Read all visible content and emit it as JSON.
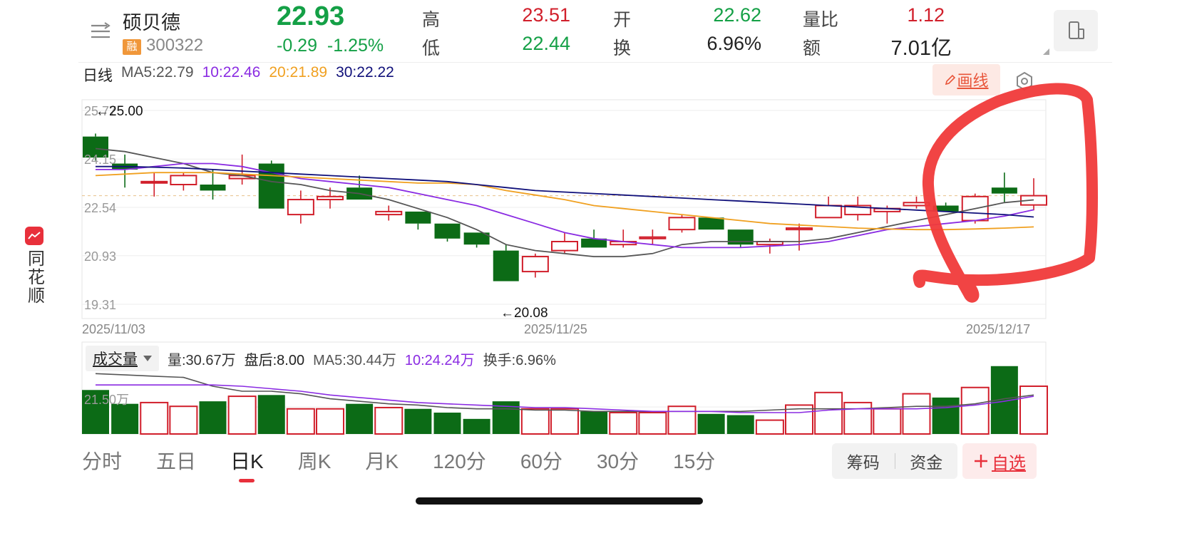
{
  "app": {
    "name": "同花顺"
  },
  "stock": {
    "name": "硕贝德",
    "badge": "融",
    "code": "300322",
    "price": "22.93",
    "change": "-0.29",
    "change_pct": "-1.25%"
  },
  "quote": {
    "high_label": "高",
    "high": "23.51",
    "low_label": "低",
    "low": "22.44",
    "open_label": "开",
    "open": "22.62",
    "turnover_label": "换",
    "turnover": "6.96%",
    "vol_ratio_label": "量比",
    "vol_ratio": "1.12",
    "amount_label": "额",
    "amount": "7.01亿"
  },
  "ma_line": {
    "period": "日线",
    "ma5": "MA5:22.79",
    "ma10": "10:22.46",
    "ma20": "20:21.89",
    "ma30": "30:22.22"
  },
  "toolbar": {
    "draw_label": "画线"
  },
  "volume_bar": {
    "selector": "成交量",
    "vol": "量:30.67万",
    "after": "盘后:8.00",
    "ma5": "MA5:30.44万",
    "ma10": "10:24.24万",
    "turnover": "换手:6.96%"
  },
  "tabs": [
    "分时",
    "五日",
    "日K",
    "周K",
    "月K",
    "120分",
    "60分",
    "30分",
    "15分"
  ],
  "active_tab": 2,
  "buttons": {
    "chips": "筹码",
    "funds": "资金",
    "add": "自选"
  },
  "colors": {
    "up": "#d11f2b",
    "down": "#0c6b16",
    "ma5": "#555555",
    "ma10": "#8a2be2",
    "ma20": "#f0a020",
    "ma30": "#10107a",
    "annotation": "#f03a3a"
  },
  "chart_data": {
    "type": "candlestick",
    "y_ticks": [
      "25.77",
      "24.15",
      "22.54",
      "20.93",
      "19.31"
    ],
    "ylim": [
      19.31,
      25.77
    ],
    "x_ticks": [
      "2025/11/03",
      "2025/11/25",
      "2025/12/17"
    ],
    "max_label": "←25.00",
    "min_label": "←20.08",
    "candles": [
      {
        "o": 24.9,
        "c": 24.2,
        "h": 25.0,
        "l": 24.1
      },
      {
        "o": 24.0,
        "c": 23.8,
        "h": 24.3,
        "l": 23.2
      },
      {
        "o": 23.4,
        "c": 23.4,
        "h": 23.7,
        "l": 22.9
      },
      {
        "o": 23.3,
        "c": 23.6,
        "h": 23.7,
        "l": 23.1
      },
      {
        "o": 23.3,
        "c": 23.1,
        "h": 23.8,
        "l": 22.8
      },
      {
        "o": 23.5,
        "c": 23.6,
        "h": 24.3,
        "l": 23.3
      },
      {
        "o": 24.0,
        "c": 22.5,
        "h": 24.1,
        "l": 22.5
      },
      {
        "o": 22.3,
        "c": 22.8,
        "h": 23.1,
        "l": 22.0
      },
      {
        "o": 22.8,
        "c": 22.9,
        "h": 23.2,
        "l": 22.5
      },
      {
        "o": 23.2,
        "c": 22.8,
        "h": 23.6,
        "l": 22.8
      },
      {
        "o": 22.3,
        "c": 22.4,
        "h": 22.6,
        "l": 22.1
      },
      {
        "o": 22.4,
        "c": 22.0,
        "h": 22.4,
        "l": 21.8
      },
      {
        "o": 22.0,
        "c": 21.5,
        "h": 22.0,
        "l": 21.4
      },
      {
        "o": 21.7,
        "c": 21.3,
        "h": 21.7,
        "l": 21.2
      },
      {
        "o": 21.1,
        "c": 20.08,
        "h": 21.3,
        "l": 20.08
      },
      {
        "o": 20.4,
        "c": 20.9,
        "h": 21.0,
        "l": 20.2
      },
      {
        "o": 21.1,
        "c": 21.4,
        "h": 21.7,
        "l": 21.0
      },
      {
        "o": 21.5,
        "c": 21.2,
        "h": 21.8,
        "l": 21.2
      },
      {
        "o": 21.3,
        "c": 21.4,
        "h": 21.8,
        "l": 21.2
      },
      {
        "o": 21.5,
        "c": 21.55,
        "h": 21.8,
        "l": 21.3
      },
      {
        "o": 21.8,
        "c": 22.2,
        "h": 22.3,
        "l": 21.7
      },
      {
        "o": 22.2,
        "c": 21.8,
        "h": 22.2,
        "l": 21.8
      },
      {
        "o": 21.8,
        "c": 21.3,
        "h": 21.8,
        "l": 21.2
      },
      {
        "o": 21.3,
        "c": 21.4,
        "h": 21.5,
        "l": 21.0
      },
      {
        "o": 21.8,
        "c": 21.85,
        "h": 22.0,
        "l": 21.1
      },
      {
        "o": 22.2,
        "c": 22.6,
        "h": 22.9,
        "l": 22.2
      },
      {
        "o": 22.3,
        "c": 22.6,
        "h": 22.9,
        "l": 22.1
      },
      {
        "o": 22.4,
        "c": 22.5,
        "h": 22.6,
        "l": 22.0
      },
      {
        "o": 22.6,
        "c": 22.7,
        "h": 22.9,
        "l": 22.5
      },
      {
        "o": 22.6,
        "c": 22.4,
        "h": 22.7,
        "l": 22.4
      },
      {
        "o": 22.1,
        "c": 22.9,
        "h": 23.0,
        "l": 22.0
      },
      {
        "o": 23.2,
        "c": 23.0,
        "h": 23.7,
        "l": 22.7
      },
      {
        "o": 22.62,
        "c": 22.93,
        "h": 23.51,
        "l": 22.44
      }
    ],
    "ma5": [
      24.5,
      24.4,
      24.2,
      24.0,
      23.7,
      23.6,
      23.4,
      23.3,
      23.1,
      23.0,
      22.8,
      22.5,
      22.2,
      21.8,
      21.3,
      21.1,
      21.0,
      20.9,
      20.9,
      21.0,
      21.3,
      21.4,
      21.4,
      21.4,
      21.4,
      21.5,
      21.7,
      21.9,
      22.1,
      22.3,
      22.5,
      22.7,
      22.79
    ],
    "ma10": [
      23.8,
      23.8,
      23.9,
      24.0,
      24.0,
      23.9,
      23.7,
      23.5,
      23.4,
      23.3,
      23.2,
      23.0,
      22.8,
      22.6,
      22.3,
      22.0,
      21.7,
      21.5,
      21.4,
      21.3,
      21.2,
      21.2,
      21.2,
      21.25,
      21.3,
      21.4,
      21.6,
      21.8,
      21.9,
      22.0,
      22.1,
      22.25,
      22.46
    ],
    "ma20": [
      23.6,
      23.65,
      23.7,
      23.7,
      23.7,
      23.65,
      23.6,
      23.55,
      23.5,
      23.45,
      23.4,
      23.35,
      23.35,
      23.3,
      23.1,
      22.95,
      22.8,
      22.6,
      22.5,
      22.4,
      22.3,
      22.2,
      22.1,
      22.0,
      21.95,
      21.9,
      21.85,
      21.82,
      21.8,
      21.8,
      21.82,
      21.85,
      21.89
    ],
    "ma30": [
      23.9,
      23.9,
      23.88,
      23.85,
      23.8,
      23.75,
      23.7,
      23.65,
      23.6,
      23.55,
      23.5,
      23.45,
      23.4,
      23.3,
      23.2,
      23.1,
      23.05,
      23.0,
      22.95,
      22.9,
      22.85,
      22.8,
      22.75,
      22.7,
      22.65,
      22.6,
      22.55,
      22.5,
      22.45,
      22.4,
      22.35,
      22.3,
      22.22
    ],
    "volume": {
      "ylim": [
        0,
        55
      ],
      "label": "21.50万",
      "values": [
        35,
        24,
        25,
        22,
        26,
        30,
        31,
        20,
        20,
        24,
        21,
        20,
        17,
        12,
        26,
        20,
        20,
        18,
        17,
        17,
        22,
        16,
        15,
        11,
        23,
        33,
        25,
        20,
        32,
        29,
        37,
        54,
        38
      ],
      "ma5": [
        48,
        47,
        46,
        45,
        38,
        34,
        34,
        32,
        28,
        26,
        24,
        23,
        21,
        20,
        20,
        19,
        19,
        18,
        18,
        18,
        18,
        18,
        18,
        19,
        20,
        20,
        20,
        21,
        22,
        22,
        24,
        28,
        31
      ],
      "ma10": [
        39,
        39,
        39,
        39,
        39,
        38,
        36,
        34,
        31,
        29,
        27,
        25,
        24,
        23,
        22,
        21,
        21,
        20,
        19,
        18,
        18,
        18,
        17,
        17,
        17,
        19,
        20,
        20,
        20,
        21,
        23,
        26,
        30
      ]
    }
  }
}
